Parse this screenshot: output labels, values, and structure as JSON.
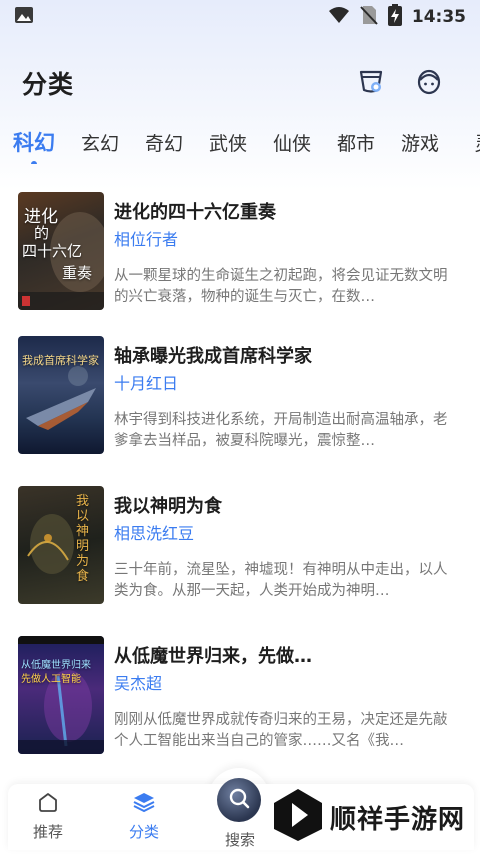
{
  "status_bar": {
    "time": "14:35"
  },
  "header": {
    "title": "分类"
  },
  "tabs": [
    {
      "label": "科幻",
      "active": true
    },
    {
      "label": "玄幻",
      "active": false
    },
    {
      "label": "奇幻",
      "active": false
    },
    {
      "label": "武侠",
      "active": false
    },
    {
      "label": "仙侠",
      "active": false
    },
    {
      "label": "都市",
      "active": false
    },
    {
      "label": "游戏",
      "active": false
    },
    {
      "label": "灵",
      "active": false
    }
  ],
  "books": [
    {
      "title": "进化的四十六亿重奏",
      "author": "相位行者",
      "description": "从一颗星球的生命诞生之初起跑，将会见证无数文明的兴亡衰落，物种的诞生与灭亡，在数…",
      "cover_text": [
        "进化",
        "的",
        "四十六亿",
        "重奏"
      ]
    },
    {
      "title": "轴承曝光我成首席科学家",
      "author": "十月红日",
      "description": "林宇得到科技进化系统，开局制造出耐高温轴承，老爹拿去当样品，被夏科院曝光，震惊整…",
      "cover_text": [
        "我成首席科学家"
      ]
    },
    {
      "title": "我以神明为食",
      "author": "相思洗红豆",
      "description": "三十年前，流星坠，神墟现！有神明从中走出，以人类为食。从那一天起，人类开始成为神明…",
      "cover_text": [
        "我以神明为食"
      ]
    },
    {
      "title": "从低魔世界归来，先做…",
      "author": "吴杰超",
      "description": "刚刚从低魔世界成就传奇归来的王易，决定还是先敲个人工智能出来当自己的管家……又名《我…",
      "cover_text": [
        "从低魔世界归来",
        "先做人工智能"
      ]
    }
  ],
  "bottom_nav": {
    "items": [
      {
        "label": "推荐",
        "active": false
      },
      {
        "label": "分类",
        "active": true
      },
      {
        "label": "搜索",
        "active": false
      }
    ]
  },
  "watermark": {
    "text": "顺祥手游网"
  },
  "colors": {
    "accent": "#3b7cf0",
    "title_text": "#1e1e1e",
    "desc_text": "#777777"
  }
}
